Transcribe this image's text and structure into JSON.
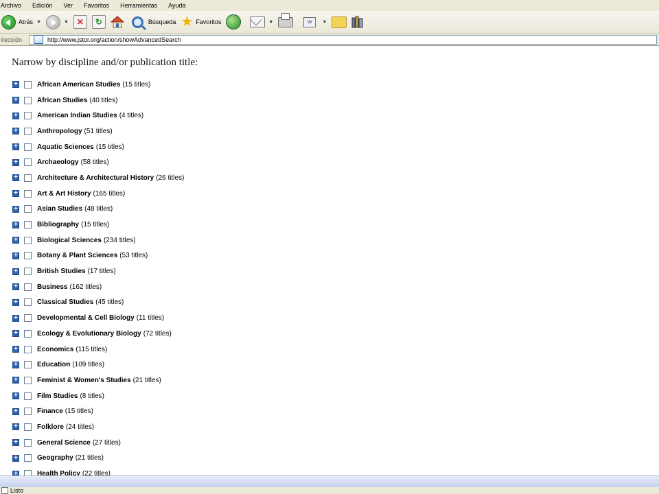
{
  "menu": [
    "Archivo",
    "Edición",
    "Ver",
    "Favoritos",
    "Herramientas",
    "Ayuda"
  ],
  "toolbar": {
    "back_label": "Atrás",
    "search_label": "Búsqueda",
    "favorites_label": "Favoritos",
    "edit_label": "W"
  },
  "address": {
    "label": "irección",
    "url": "http://www.jstor.org/action/showAdvancedSearch"
  },
  "page": {
    "heading": "Narrow by discipline and/or publication title:",
    "disciplines": [
      {
        "name": "African American Studies",
        "count": "(15 titles)"
      },
      {
        "name": "African Studies",
        "count": "(40 titles)"
      },
      {
        "name": "American Indian Studies",
        "count": "(4 titles)"
      },
      {
        "name": "Anthropology",
        "count": "(51 titles)"
      },
      {
        "name": "Aquatic Sciences",
        "count": "(15 titles)"
      },
      {
        "name": "Archaeology",
        "count": "(58 titles)"
      },
      {
        "name": "Architecture & Architectural History",
        "count": "(26 titles)"
      },
      {
        "name": "Art & Art History",
        "count": "(165 titles)"
      },
      {
        "name": "Asian Studies",
        "count": "(48 titles)"
      },
      {
        "name": "Bibliography",
        "count": "(15 titles)"
      },
      {
        "name": "Biological Sciences",
        "count": "(234 titles)"
      },
      {
        "name": "Botany & Plant Sciences",
        "count": "(53 titles)"
      },
      {
        "name": "British Studies",
        "count": "(17 titles)"
      },
      {
        "name": "Business",
        "count": "(162 titles)"
      },
      {
        "name": "Classical Studies",
        "count": "(45 titles)"
      },
      {
        "name": "Developmental & Cell Biology",
        "count": "(11 titles)"
      },
      {
        "name": "Ecology & Evolutionary Biology",
        "count": "(72 titles)"
      },
      {
        "name": "Economics",
        "count": "(115 titles)"
      },
      {
        "name": "Education",
        "count": "(109 titles)"
      },
      {
        "name": "Feminist & Women's Studies",
        "count": "(21 titles)"
      },
      {
        "name": "Film Studies",
        "count": "(8 titles)"
      },
      {
        "name": "Finance",
        "count": "(15 titles)"
      },
      {
        "name": "Folklore",
        "count": "(24 titles)"
      },
      {
        "name": "General Science",
        "count": "(27 titles)"
      },
      {
        "name": "Geography",
        "count": "(21 titles)"
      },
      {
        "name": "Health Policy",
        "count": "(22 titles)"
      }
    ]
  },
  "status": {
    "text": "Listo"
  },
  "colors": {
    "expander": "#2d61a8",
    "chrome": "#ece9d8"
  }
}
